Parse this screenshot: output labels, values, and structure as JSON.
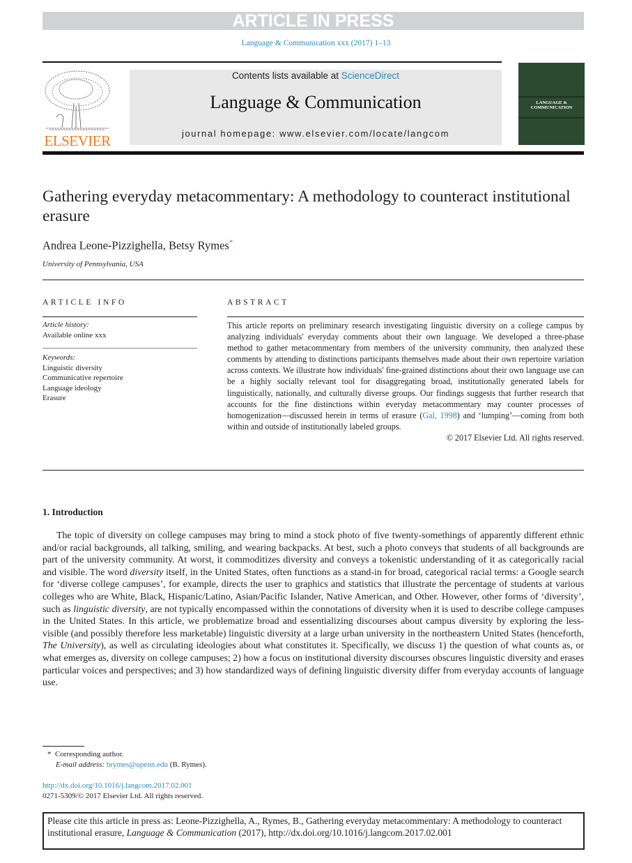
{
  "banner": "ARTICLE IN PRESS",
  "citation_line": "Language & Communication xxx (2017) 1–13",
  "masthead": {
    "contents_prefix": "Contents lists available at ",
    "contents_link": "ScienceDirect",
    "journal_name": "Language & Communication",
    "homepage": "journal homepage: www.elsevier.com/locate/langcom",
    "publisher_logo_text": "ELSEVIER",
    "cover_text": "LANGUAGE & COMMUNICATION"
  },
  "article": {
    "title": "Gathering everyday metacommentary: A methodology to counteract institutional erasure",
    "authors": "Andrea Leone-Pizzighella, Betsy Rymes",
    "author_mark": "*",
    "affiliation": "University of Pennsylvania, USA"
  },
  "article_info": {
    "heading": "ARTICLE INFO",
    "history_label": "Article history:",
    "history_value": "Available online xxx",
    "keywords_label": "Keywords:",
    "keywords": [
      "Linguistic diversity",
      "Communicative repertoire",
      "Language ideology",
      "Erasure"
    ]
  },
  "abstract": {
    "heading": "ABSTRACT",
    "text_before_link": "This article reports on preliminary research investigating linguistic diversity on a college campus by analyzing individuals' everyday comments about their own language. We developed a three-phase method to gather metacommentary from members of the university community, then analyzed these comments by attending to distinctions participants themselves made about their own repertoire variation across contexts. We illustrate how individuals' fine-grained distinctions about their own language use can be a highly socially relevant tool for disaggregating broad, institutionally generated labels for linguistically, nationally, and culturally diverse groups. Our findings suggests that further research that accounts for the fine distinctions within everyday metacommentary may counter processes of homogenization—discussed herein in terms of erasure (",
    "link": "Gal, 1998",
    "text_after_link": ") and ‘lumping’—coming from both within and outside of institutionally labeled groups.",
    "copyright": "© 2017 Elsevier Ltd. All rights reserved."
  },
  "section1": {
    "heading": "1.  Introduction",
    "p1": "The topic of diversity on college campuses may bring to mind a stock photo of five twenty-somethings of apparently different ethnic and/or racial backgrounds, all talking, smiling, and wearing backpacks. At best, such a photo conveys that students of all backgrounds are part of the university community. At worst, it commoditizes diversity and conveys a tokenistic understanding of it as categorically racial and visible. The word ",
    "i1": "diversity",
    "p2": " itself, in the United States, often functions as a stand-in for broad, categorical racial terms: a Google search for ‘diverse college campuses’, for example, directs the user to graphics and statistics that illustrate the percentage of students at various colleges who are White, Black, Hispanic/Latino, Asian/Pacific Islander, Native American, and Other. However, other forms of ‘diversity’, such as ",
    "i2": "linguistic diversity",
    "p3": ", are not typically encompassed within the connotations of diversity when it is used to describe college campuses in the United States. In this article, we problematize broad and essentializing discourses about campus diversity by exploring the less-visible (and possibly therefore less marketable) linguistic diversity at a large urban university in the northeastern United States (henceforth, ",
    "i3": "The University",
    "p4": "), as well as circulating ideologies about what constitutes it. Specifically, we discuss 1) the question of what counts as, or what emerges as, diversity on college campuses; 2) how a focus on institutional diversity discourses obscures linguistic diversity and erases particular voices and perspectives; and 3) how standardized ways of defining linguistic diversity differ from everyday accounts of language use."
  },
  "footnote": {
    "mark": "*",
    "corresponding": "Corresponding author.",
    "email_label": "E-mail address:",
    "email": "brymes@upenn.edu",
    "email_suffix": "(B. Rymes)."
  },
  "doi": "http://dx.doi.org/10.1016/j.langcom.2017.02.001",
  "issn": "0271-5309/© 2017 Elsevier Ltd. All rights reserved.",
  "cite_box": {
    "text1": "Please cite this article in press as: Leone-Pizzighella, A., Rymes, B., Gathering everyday metacommentary: A methodology to counteract institutional erasure, ",
    "journal": "Language & Communication",
    "text2": " (2017), http://dx.doi.org/10.1016/j.langcom.2017.02.001"
  },
  "colors": {
    "link": "#2a8ab8",
    "elsevier_orange": "#f07a21",
    "banner_gray": "#d1d2d4",
    "cover_green": "#2b4a30"
  }
}
